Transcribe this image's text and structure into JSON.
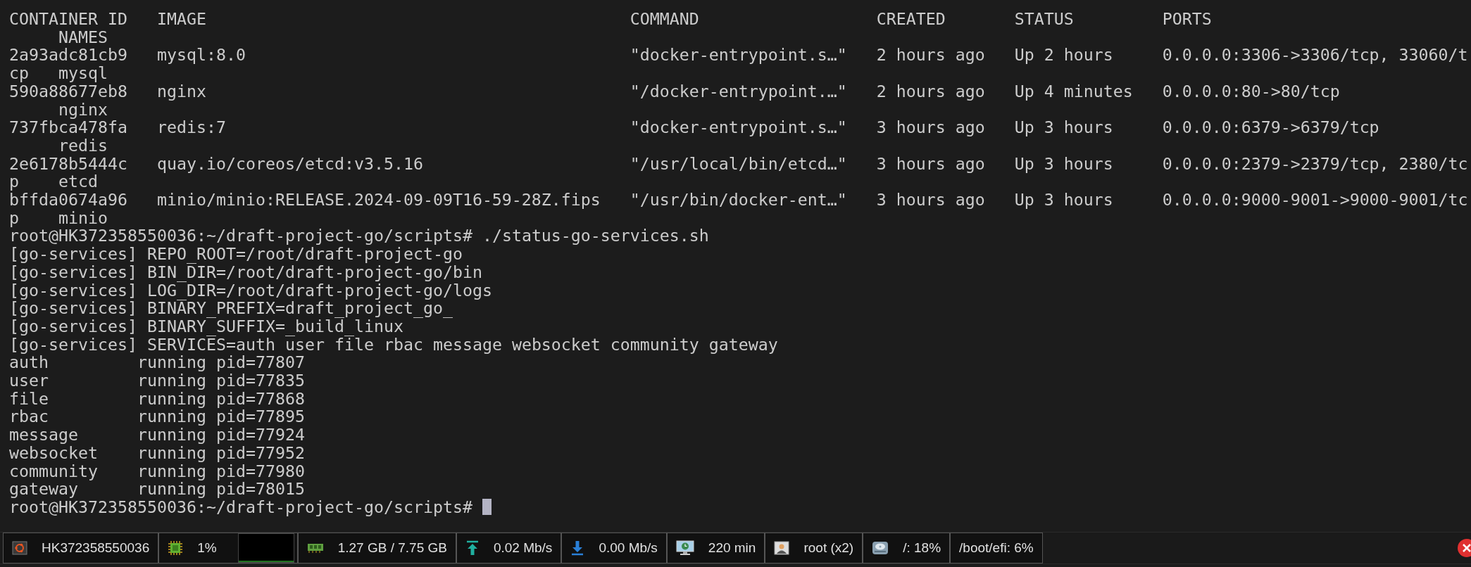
{
  "docker_ps": {
    "header": {
      "cells": [
        "CONTAINER ID",
        "IMAGE",
        "COMMAND",
        "CREATED",
        "STATUS",
        "PORTS"
      ],
      "names": "NAMES"
    },
    "rows": [
      {
        "container_id": "2a93adc81cb9",
        "image": "mysql:8.0",
        "command": "\"docker-entrypoint.s…\"",
        "created": "2 hours ago",
        "status": "Up 2 hours",
        "ports": "0.0.0.0:3306->3306/tcp, 33060/t",
        "ports_wrap": "cp",
        "name": "mysql"
      },
      {
        "container_id": "590a88677eb8",
        "image": "nginx",
        "command": "\"/docker-entrypoint.…\"",
        "created": "2 hours ago",
        "status": "Up 4 minutes",
        "ports": "0.0.0.0:80->80/tcp",
        "name": "nginx"
      },
      {
        "container_id": "737fbca478fa",
        "image": "redis:7",
        "command": "\"docker-entrypoint.s…\"",
        "created": "3 hours ago",
        "status": "Up 3 hours",
        "ports": "0.0.0.0:6379->6379/tcp",
        "name": "redis"
      },
      {
        "container_id": "2e6178b5444c",
        "image": "quay.io/coreos/etcd:v3.5.16",
        "command": "\"/usr/local/bin/etcd…\"",
        "created": "3 hours ago",
        "status": "Up 3 hours",
        "ports": "0.0.0.0:2379->2379/tcp, 2380/tc",
        "ports_wrap": "p",
        "name": "etcd"
      },
      {
        "container_id": "bffda0674a96",
        "image": "minio/minio:RELEASE.2024-09-09T16-59-28Z.fips",
        "command": "\"/usr/bin/docker-ent…\"",
        "created": "3 hours ago",
        "status": "Up 3 hours",
        "ports": "0.0.0.0:9000-9001->9000-9001/tc",
        "ports_wrap": "p",
        "name": "minio"
      }
    ]
  },
  "command_line": "root@HK372358550036:~/draft-project-go/scripts# ./status-go-services.sh",
  "script_output": [
    "[go-services] REPO_ROOT=/root/draft-project-go",
    "[go-services] BIN_DIR=/root/draft-project-go/bin",
    "[go-services] LOG_DIR=/root/draft-project-go/logs",
    "[go-services] BINARY_PREFIX=draft_project_go_",
    "[go-services] BINARY_SUFFIX=_build_linux",
    "[go-services] SERVICES=auth user file rbac message websocket community gateway"
  ],
  "services": [
    {
      "name": "auth",
      "status": "running pid=77807"
    },
    {
      "name": "user",
      "status": "running pid=77835"
    },
    {
      "name": "file",
      "status": "running pid=77868"
    },
    {
      "name": "rbac",
      "status": "running pid=77895"
    },
    {
      "name": "message",
      "status": "running pid=77924"
    },
    {
      "name": "websocket",
      "status": "running pid=77952"
    },
    {
      "name": "community",
      "status": "running pid=77980"
    },
    {
      "name": "gateway",
      "status": "running pid=78015"
    }
  ],
  "prompt": {
    "text": "root@HK372358550036:~/draft-project-go/scripts#",
    "cursor": true
  },
  "status_bar": [
    {
      "kind": "host",
      "text": "HK372358550036"
    },
    {
      "kind": "cpu",
      "text": "1%"
    },
    {
      "kind": "memory",
      "text": "1.27 GB / 7.75 GB"
    },
    {
      "kind": "upload",
      "text": "0.02 Mb/s"
    },
    {
      "kind": "download",
      "text": "0.00 Mb/s"
    },
    {
      "kind": "uptime",
      "text": "220 min"
    },
    {
      "kind": "users",
      "text": "root (x2)"
    },
    {
      "kind": "disk",
      "text": "/: 18%"
    },
    {
      "kind": "plain",
      "text": "/boot/efi: 6%"
    }
  ]
}
